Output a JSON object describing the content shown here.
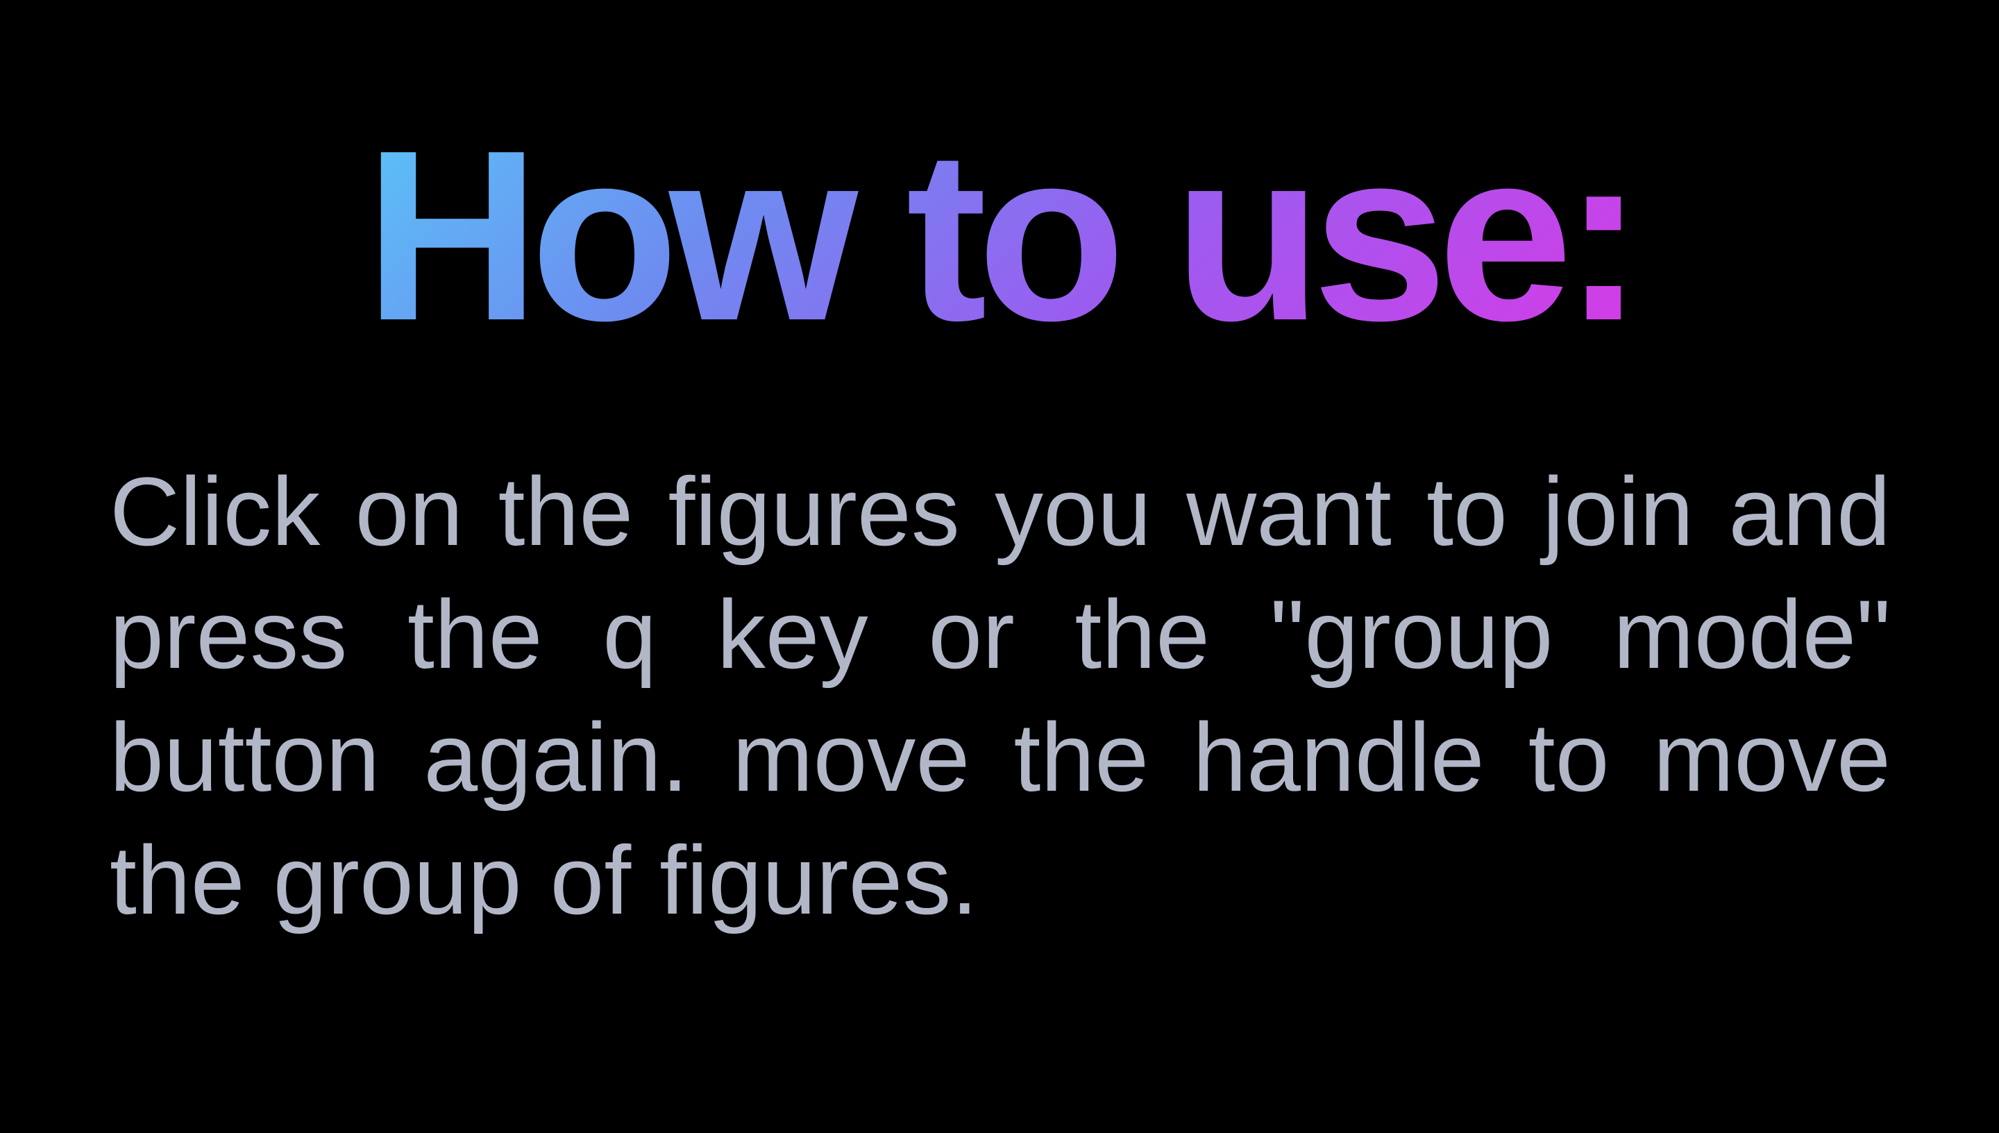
{
  "heading": {
    "text": "How to use:",
    "gradient_colors": [
      "#5bc3f7",
      "#6d8cf0",
      "#9a5df0",
      "#d63ae6"
    ]
  },
  "instructions": {
    "text": "Click on the figures you want to join and press the q key or the \"group mode\" button again. move the handle to move the group of figures.",
    "color": "#b2b7c8"
  },
  "background_color": "#000000"
}
